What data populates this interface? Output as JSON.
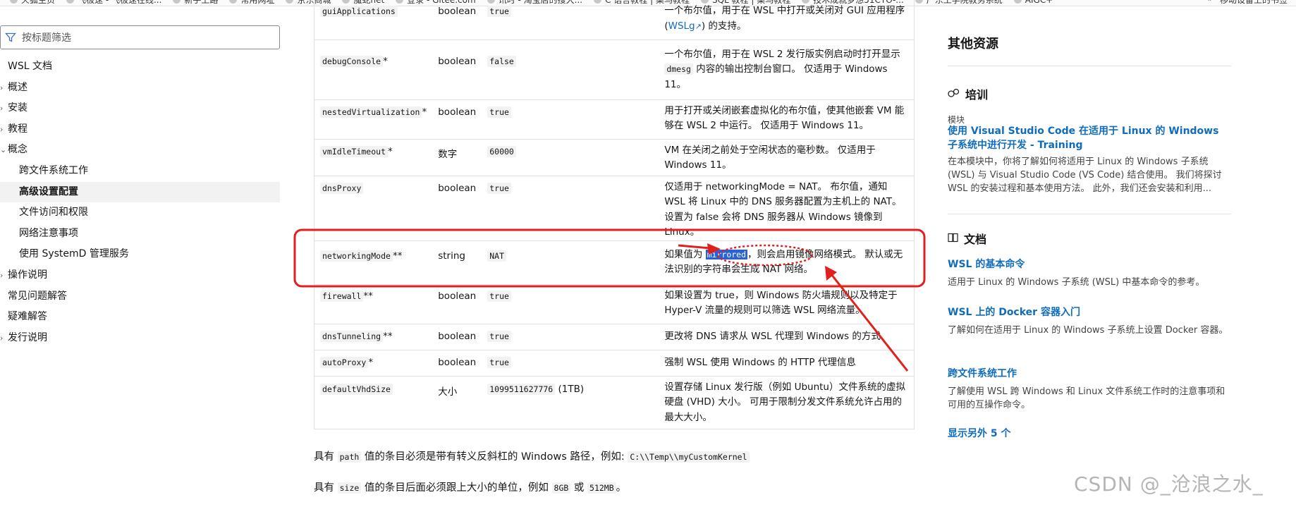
{
  "bookmarks": [
    "火狐主页",
    "飞极速 - 飞极速在线...",
    "新手上路",
    "常用网址",
    "京东商城",
    "魔蛇net",
    "登录 - Gitee.com",
    "讯时 - 淘宝店的搜大...",
    "C 语言教程 | 菜鸟教程",
    "SQL 教程 | 菜鸟教程",
    "技术成就梦想51CTO-...",
    "广东工学院教务系统",
    "AIGC+"
  ],
  "bookmarks_right": [
    "»",
    "移动设备上的书签"
  ],
  "sidebar": {
    "filter_placeholder": "按标题筛选",
    "items": [
      {
        "label": "WSL 文档",
        "chev": ""
      },
      {
        "label": "概述",
        "chev": "›"
      },
      {
        "label": "安装",
        "chev": "›"
      },
      {
        "label": "教程",
        "chev": "›"
      },
      {
        "label": "概念",
        "chev": "⌄"
      },
      {
        "label": "跨文件系统工作",
        "chev": ""
      },
      {
        "label": "高级设置配置",
        "chev": ""
      },
      {
        "label": "文件访问和权限",
        "chev": ""
      },
      {
        "label": "网络注意事项",
        "chev": ""
      },
      {
        "label": "使用 SystemD 管理服务",
        "chev": ""
      },
      {
        "label": "操作说明",
        "chev": "›"
      },
      {
        "label": "常见问题解答",
        "chev": ""
      },
      {
        "label": "疑难解答",
        "chev": ""
      },
      {
        "label": "发行说明",
        "chev": "›"
      }
    ]
  },
  "table": {
    "rows": [
      {
        "key": "guiApplications",
        "star": "",
        "type": "boolean",
        "default": "true",
        "default_suffix": "",
        "desc": "一个布尔值，用于在 WSL 中打开或关闭对 GUI 应用程序",
        "desc_link": "WSLg",
        "desc_tail": ") 的支持。"
      },
      {
        "key": "debugConsole",
        "star": "*",
        "type": "boolean",
        "default": "false",
        "default_suffix": "",
        "desc_pre": "一个布尔值，用于在 WSL 2 发行版实例启动时打开显示",
        "desc_code": "dmesg",
        "desc_post": "内容的输出控制台窗口。 仅适用于 Windows 11。"
      },
      {
        "key": "nestedVirtualization",
        "star": "*",
        "type": "boolean",
        "default": "true",
        "default_suffix": "",
        "desc": "用于打开或关闭嵌套虚拟化的布尔值，使其他嵌套 VM 能够在 WSL 2 中运行。 仅适用于 Windows 11。"
      },
      {
        "key": "vmIdleTimeout",
        "star": "*",
        "type": "数字",
        "default": "60000",
        "default_suffix": "",
        "desc": "VM 在关闭之前处于空闲状态的毫秒数。 仅适用于 Windows 11。"
      },
      {
        "key": "dnsProxy",
        "star": "",
        "type": "boolean",
        "default": "true",
        "default_suffix": "",
        "desc": "仅适用于 networkingMode = NAT。 布尔值，通知 WSL 将 Linux 中的 DNS 服务器配置为主机上的 NAT。 设置为 false 会将 DNS 服务器从 Windows 镜像到 Linux。"
      },
      {
        "key": "networkingMode",
        "star": "**",
        "type": "string",
        "default": "NAT",
        "default_suffix": "",
        "desc_pre": "如果值为",
        "desc_code": "mirrored",
        "desc_post": "，则会启用镜像网络模式。 默认或无法识别的字符串会生成 NAT 网络。"
      },
      {
        "key": "firewall",
        "star": "**",
        "type": "boolean",
        "default": "true",
        "default_suffix": "",
        "desc": "如果设置为 true，则 Windows 防火墙规则以及特定于 Hyper-V 流量的规则可以筛选 WSL 网络流量。"
      },
      {
        "key": "dnsTunneling",
        "star": "**",
        "type": "boolean",
        "default": "true",
        "default_suffix": "",
        "desc": "更改将 DNS 请求从 WSL 代理到 Windows 的方式"
      },
      {
        "key": "autoProxy",
        "star": "*",
        "type": "boolean",
        "default": "true",
        "default_suffix": "",
        "desc": "强制 WSL 使用 Windows 的 HTTP 代理信息"
      },
      {
        "key": "defaultVhdSize",
        "star": "",
        "type": "大小",
        "default": "1099511627776",
        "default_suffix": " (1TB)",
        "desc": "设置存储 Linux 发行版（例如 Ubuntu）文件系统的虚拟硬盘 (VHD) 大小。 可用于限制分发文件系统允许占用的最大大小。"
      }
    ]
  },
  "paragraphs": {
    "p1_pre": "具有",
    "p1_code": "path",
    "p1_mid": "值的条目必须是带有转义反斜杠的 Windows 路径，例如:",
    "p1_code2": "C:\\\\Temp\\\\myCustomKernel",
    "p2_pre": "具有",
    "p2_code": "size",
    "p2_mid": "值的条目后面必须跟上大小的单位，例如",
    "p2_code2": "8GB",
    "p2_or": "或",
    "p2_code3": "512MB",
    "p2_end": "。"
  },
  "aside": {
    "heading": "其他资源",
    "training": {
      "heading": "培训",
      "kind": "模块",
      "title": "使用 Visual Studio Code 在适用于 Linux 的 Windows 子系统中进行开发 - Training",
      "desc": "在本模块中，你将了解如何将适用于 Linux 的 Windows 子系统 (WSL) 与 Visual Studio Code (VS Code) 结合使用。 我们将探讨 WSL 的安装过程和基本使用方法。 此外，我们还会安装和利用..."
    },
    "docs": {
      "heading": "文档",
      "items": [
        {
          "title": "WSL 的基本命令",
          "desc": "适用于 Linux 的 Windows 子系统 (WSL) 中基本命令的参考。"
        },
        {
          "title": "WSL 上的 Docker 容器入门",
          "desc": "了解如何在适用于 Linux 的 Windows 子系统上设置 Docker 容器。"
        },
        {
          "title": "跨文件系统工作",
          "desc": "了解使用 WSL 跨 Windows 和 Linux 文件系统工作时的注意事项和可用的互操作命令。"
        }
      ],
      "show_more": "显示另外 5 个"
    }
  },
  "watermark": "CSDN @_沧浪之水_",
  "colors": {
    "link": "#0f6cbd",
    "annotation": "#e0201c",
    "highlight": "#2a62d6"
  }
}
